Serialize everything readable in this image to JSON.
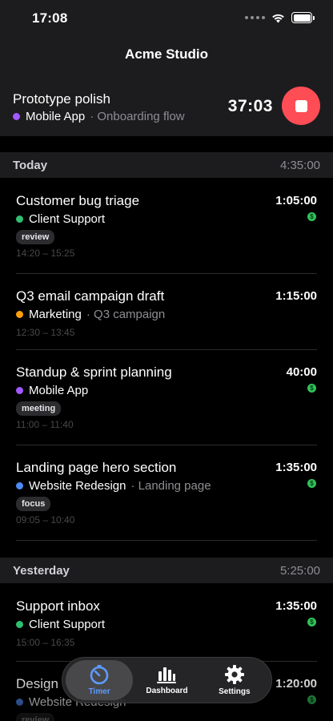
{
  "status": {
    "time": "17:08"
  },
  "header": {
    "title": "Acme Studio"
  },
  "running": {
    "name": "Prototype polish",
    "project": "Mobile App",
    "project_color": "#a259ff",
    "task": "· Onboarding flow",
    "elapsed": "37:03"
  },
  "sections": [
    {
      "title": "Today",
      "total": "4:35:00",
      "entries": [
        {
          "title": "Customer bug triage",
          "project": "Client Support",
          "color": "#2fbf71",
          "task": "",
          "tag": "review",
          "range": "14:20 – 15:25",
          "duration": "1:05:00",
          "billable": true
        },
        {
          "title": "Q3 email campaign draft",
          "project": "Marketing",
          "color": "#ff9f0a",
          "task": "· Q3 campaign",
          "tag": "",
          "range": "12:30 – 13:45",
          "duration": "1:15:00",
          "billable": false
        },
        {
          "title": "Standup & sprint planning",
          "project": "Mobile App",
          "color": "#a259ff",
          "task": "",
          "tag": "meeting",
          "range": "11:00 – 11:40",
          "duration": "40:00",
          "billable": true
        },
        {
          "title": "Landing page hero section",
          "project": "Website Redesign",
          "color": "#4c8bf5",
          "task": "· Landing page",
          "tag": "focus",
          "range": "09:05 – 10:40",
          "duration": "1:35:00",
          "billable": true
        }
      ]
    },
    {
      "title": "Yesterday",
      "total": "5:25:00",
      "entries": [
        {
          "title": "Support inbox",
          "project": "Client Support",
          "color": "#2fbf71",
          "task": "",
          "tag": "",
          "range": "15:00 – 16:35",
          "duration": "1:35:00",
          "billable": true
        },
        {
          "title": "Design",
          "project": "Website Redesign",
          "color": "#4c8bf5",
          "task": "",
          "tag": "review",
          "range": "",
          "duration": "1:20:00",
          "billable": true
        }
      ]
    }
  ],
  "billable_symbol": "$",
  "tabs": [
    {
      "label": "Timer",
      "icon": "timer-icon"
    },
    {
      "label": "Dashboard",
      "icon": "chart-icon"
    },
    {
      "label": "Settings",
      "icon": "gear-icon"
    }
  ]
}
